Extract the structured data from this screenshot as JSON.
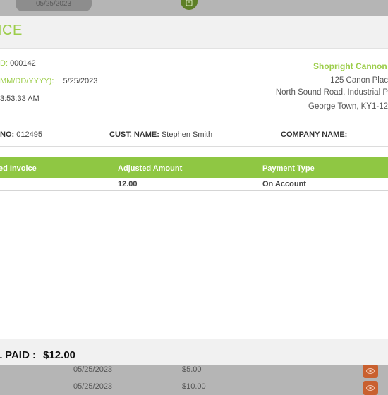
{
  "background": {
    "top_date": "05/25/2023",
    "rows": [
      {
        "date": "05/25/2023",
        "amount": "$5.00"
      },
      {
        "date": "05/25/2023",
        "amount": "$10.00"
      }
    ]
  },
  "modal": {
    "title": "ICE",
    "meta": {
      "id_label": "D:",
      "id_value": "000142",
      "date_label": "MM/DD/YYYY):",
      "date_value": "5/25/2023",
      "time_value": "3:53:33 AM"
    },
    "store": {
      "name": "Shopright Cannon P",
      "address_1": "125 Canon Plac",
      "address_2": "North Sound Road, Industrial P",
      "address_3": "George Town, KY1-12"
    },
    "info": {
      "no_label": "NO:",
      "no_value": "012495",
      "cust_label": "CUST. NAME:",
      "cust_value": "Stephen Smith",
      "company_label": "COMPANY NAME:",
      "company_value": ""
    },
    "table": {
      "headers": [
        "ed Invoice",
        "Adjusted Amount",
        "Payment Type"
      ],
      "rows": [
        {
          "invoice": "",
          "amount": "12.00",
          "payment": "On Account"
        }
      ]
    },
    "footer": {
      "total_label": "L PAID :",
      "total_value": "$12.00"
    }
  },
  "colors": {
    "accent": "#9ccd4a",
    "header_green": "#8fc743",
    "overlay": "#b5b5b5",
    "eye_button": "#c9602f"
  }
}
